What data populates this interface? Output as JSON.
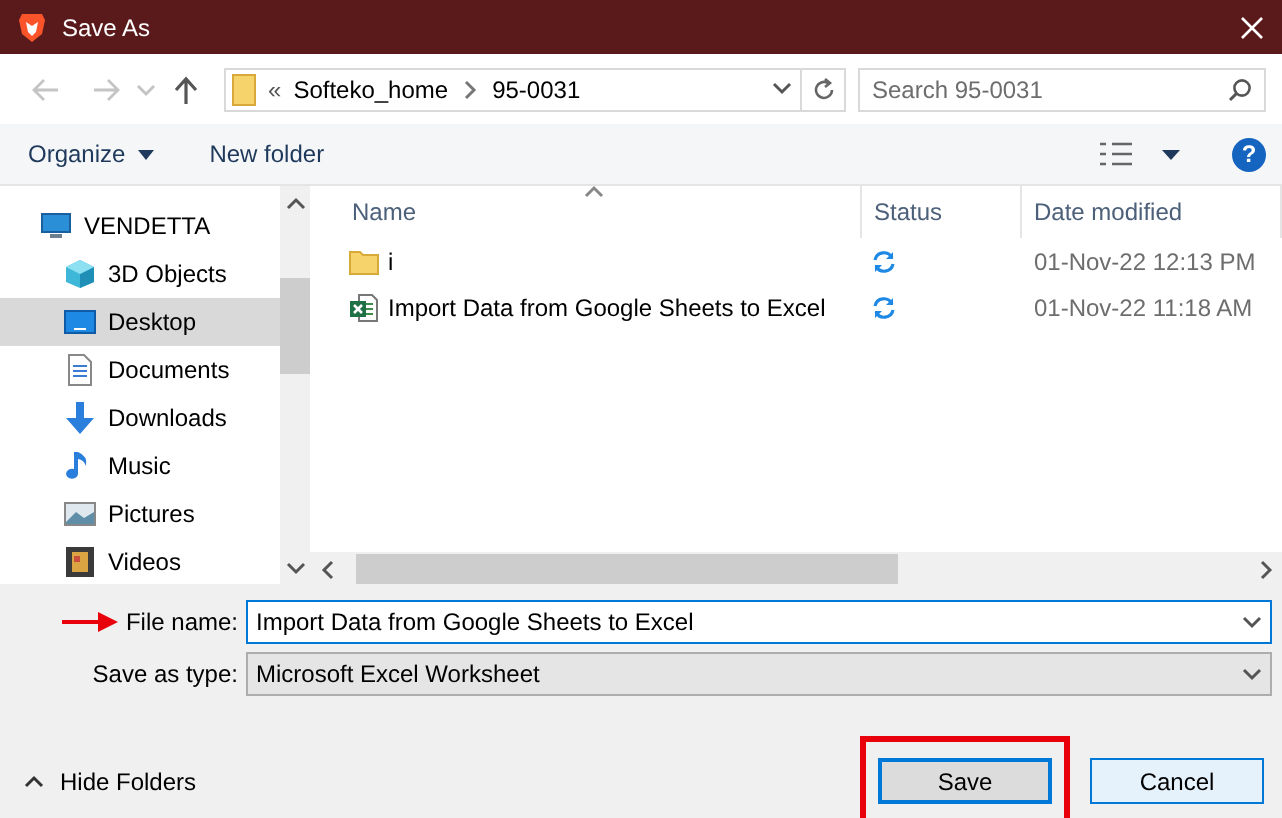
{
  "window": {
    "title": "Save As"
  },
  "address": {
    "overflow": "«",
    "crumbs": [
      "Softeko_home",
      "95-0031"
    ]
  },
  "search": {
    "placeholder": "Search 95-0031"
  },
  "toolbar": {
    "organize": "Organize",
    "new_folder": "New folder",
    "help": "?"
  },
  "nav": {
    "items": [
      {
        "label": "VENDETTA",
        "kind": "computer",
        "selected": false,
        "children": [
          {
            "label": "3D Objects",
            "kind": "cube",
            "selected": false
          },
          {
            "label": "Desktop",
            "kind": "desktop",
            "selected": true
          },
          {
            "label": "Documents",
            "kind": "document",
            "selected": false
          },
          {
            "label": "Downloads",
            "kind": "download",
            "selected": false
          },
          {
            "label": "Music",
            "kind": "music",
            "selected": false
          },
          {
            "label": "Pictures",
            "kind": "pictures",
            "selected": false
          },
          {
            "label": "Videos",
            "kind": "videos",
            "selected": false
          }
        ]
      }
    ]
  },
  "files": {
    "columns": [
      "Name",
      "Status",
      "Date modified"
    ],
    "rows": [
      {
        "kind": "folder",
        "name": "i",
        "date": "01-Nov-22 12:13 PM"
      },
      {
        "kind": "excel",
        "name": "Import Data from Google Sheets to Excel",
        "date": "01-Nov-22 11:18 AM"
      }
    ]
  },
  "file_name": {
    "label": "File name:",
    "value": "Import Data from Google Sheets to Excel",
    "marked": true
  },
  "save_as_type": {
    "label": "Save as type:",
    "value": "Microsoft Excel Worksheet"
  },
  "hide_folders": "Hide Folders",
  "buttons": [
    {
      "label": "Save",
      "default": true,
      "highlighted": true
    },
    {
      "label": "Cancel",
      "default": false,
      "highlighted": false
    }
  ]
}
